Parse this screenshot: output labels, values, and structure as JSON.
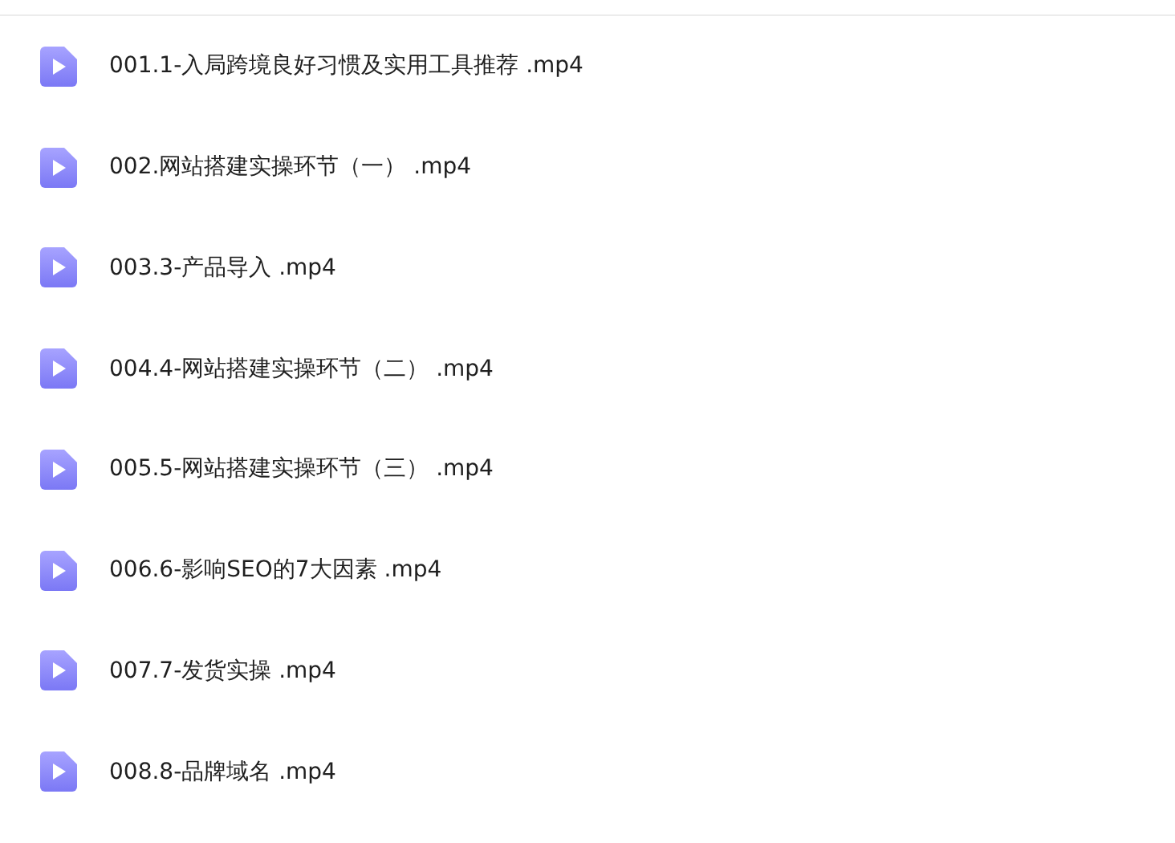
{
  "files": [
    {
      "name": "001.1-入局跨境良好习惯及实用工具推荐 .mp4"
    },
    {
      "name": "002.网站搭建实操环节（一） .mp4"
    },
    {
      "name": "003.3-产品导入 .mp4"
    },
    {
      "name": "004.4-网站搭建实操环节（二） .mp4"
    },
    {
      "name": "005.5-网站搭建实操环节（三） .mp4"
    },
    {
      "name": "006.6-影响SEO的7大因素 .mp4"
    },
    {
      "name": "007.7-发货实操 .mp4"
    },
    {
      "name": "008.8-品牌域名 .mp4"
    }
  ]
}
